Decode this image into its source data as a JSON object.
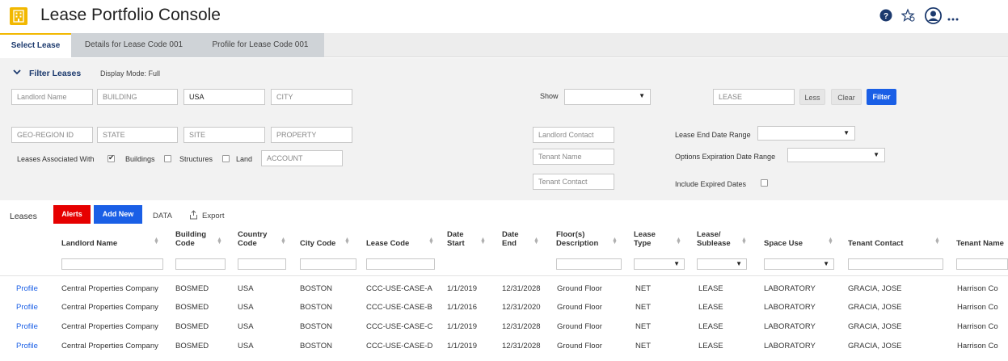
{
  "header": {
    "title": "Lease Portfolio Console",
    "icons": [
      "help-icon",
      "star-settings-icon",
      "user-icon",
      "more-icon"
    ]
  },
  "tabs": [
    {
      "label": "Select Lease",
      "active": true
    },
    {
      "label": "Details for Lease Code 001",
      "active": false
    },
    {
      "label": "Profile for Lease Code 001",
      "active": false
    }
  ],
  "filter": {
    "title": "Filter Leases",
    "mode": "Display Mode: Full",
    "fields": {
      "landlord_name": {
        "placeholder": "Landlord Name",
        "value": ""
      },
      "building": {
        "placeholder": "BUILDING",
        "value": ""
      },
      "country": {
        "placeholder": "",
        "value": "USA"
      },
      "city": {
        "placeholder": "CITY",
        "value": ""
      },
      "geo_region": {
        "placeholder": "GEO-REGION ID",
        "value": ""
      },
      "state": {
        "placeholder": "STATE",
        "value": ""
      },
      "site": {
        "placeholder": "SITE",
        "value": ""
      },
      "property": {
        "placeholder": "PROPERTY",
        "value": ""
      },
      "account": {
        "placeholder": "ACCOUNT",
        "value": ""
      },
      "lease": {
        "placeholder": "LEASE",
        "value": ""
      },
      "landlord_contact": {
        "placeholder": "Landlord Contact",
        "value": ""
      },
      "tenant_name": {
        "placeholder": "Tenant Name",
        "value": ""
      },
      "tenant_contact": {
        "placeholder": "Tenant Contact",
        "value": ""
      }
    },
    "show_label": "Show",
    "show_value": "",
    "less": "Less",
    "clear": "Clear",
    "filter_btn": "Filter",
    "assoc_label": "Leases Associated With",
    "assoc": [
      {
        "label": "Buildings",
        "checked": true
      },
      {
        "label": "Structures",
        "checked": false
      },
      {
        "label": "Land",
        "checked": false
      }
    ],
    "end_range_label": "Lease End Date Range",
    "end_range_value": "",
    "options_range_label": "Options Expiration Date Range",
    "options_range_value": "",
    "include_expired_label": "Include Expired Dates",
    "include_expired": false
  },
  "leases": {
    "title": "Leases",
    "alerts": "Alerts",
    "add_new": "Add New",
    "data": "DATA",
    "export": "Export",
    "columns": [
      {
        "line1": "Landlord Name",
        "line2": ""
      },
      {
        "line1": "Building",
        "line2": "Code"
      },
      {
        "line1": "Country",
        "line2": "Code"
      },
      {
        "line1": "City Code",
        "line2": ""
      },
      {
        "line1": "Lease Code",
        "line2": ""
      },
      {
        "line1": "Date",
        "line2": "Start"
      },
      {
        "line1": "Date",
        "line2": "End"
      },
      {
        "line1": "Floor(s)",
        "line2": "Description"
      },
      {
        "line1": "Lease",
        "line2": "Type"
      },
      {
        "line1": "Lease/",
        "line2": "Sublease"
      },
      {
        "line1": "Space Use",
        "line2": ""
      },
      {
        "line1": "Tenant Contact",
        "line2": ""
      },
      {
        "line1": "Tenant Name",
        "line2": ""
      }
    ],
    "rows": [
      {
        "link": "Profile",
        "cells": [
          "Central Properties Company",
          "BOSMED",
          "USA",
          "BOSTON",
          "CCC-USE-CASE-A",
          "1/1/2019",
          "12/31/2028",
          "Ground Floor",
          "NET",
          "LEASE",
          "LABORATORY",
          "GRACIA, JOSE",
          "Harrison Co"
        ]
      },
      {
        "link": "Profile",
        "cells": [
          "Central Properties Company",
          "BOSMED",
          "USA",
          "BOSTON",
          "CCC-USE-CASE-B",
          "1/1/2016",
          "12/31/2020",
          "Ground Floor",
          "NET",
          "LEASE",
          "LABORATORY",
          "GRACIA, JOSE",
          "Harrison Co"
        ]
      },
      {
        "link": "Profile",
        "cells": [
          "Central Properties Company",
          "BOSMED",
          "USA",
          "BOSTON",
          "CCC-USE-CASE-C",
          "1/1/2019",
          "12/31/2028",
          "Ground Floor",
          "NET",
          "LEASE",
          "LABORATORY",
          "GRACIA, JOSE",
          "Harrison Co"
        ]
      },
      {
        "link": "Profile",
        "cells": [
          "Central Properties Company",
          "BOSMED",
          "USA",
          "BOSTON",
          "CCC-USE-CASE-D",
          "1/1/2019",
          "12/31/2028",
          "Ground Floor",
          "NET",
          "LEASE",
          "LABORATORY",
          "GRACIA, JOSE",
          "Harrison Co"
        ]
      }
    ]
  },
  "colors": {
    "accent": "#f2b800",
    "primary": "#1a5fe6",
    "alert": "#e60000",
    "nav": "#1c3a6e"
  }
}
